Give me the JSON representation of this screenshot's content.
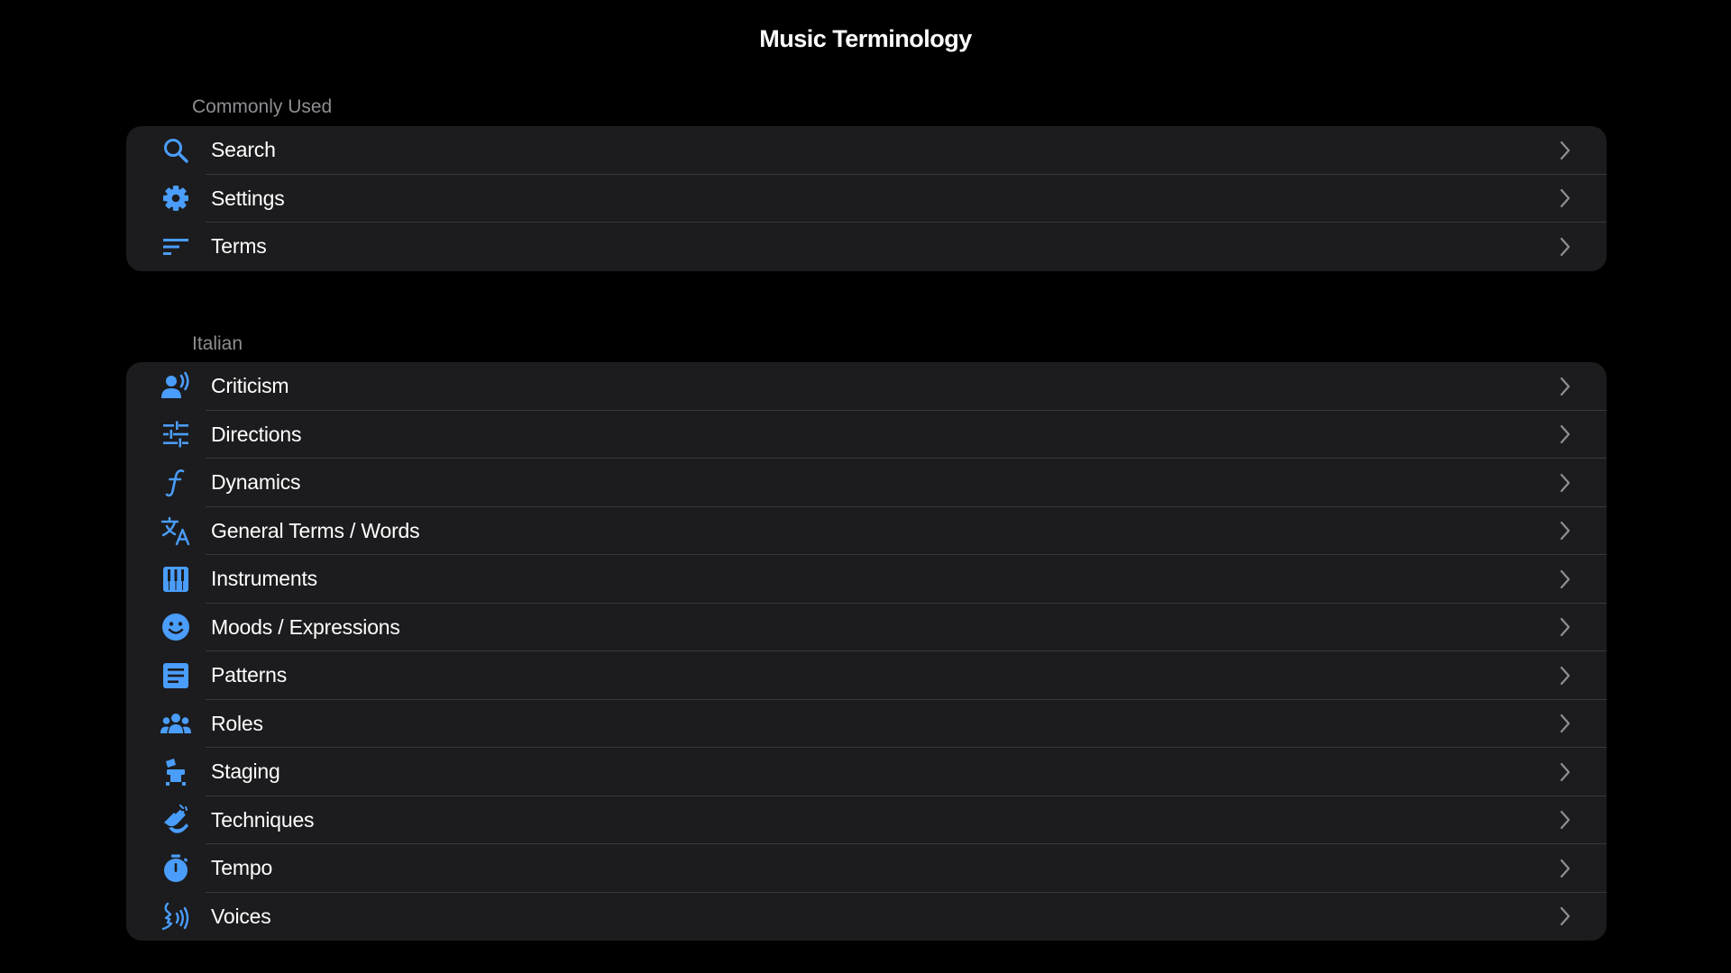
{
  "app": {
    "title": "Music Terminology"
  },
  "colors": {
    "accent": "#4a9dfb",
    "background": "#000000",
    "card": "#1c1c1e",
    "secondary_text": "#8e8e93",
    "chevron": "#8e8e93"
  },
  "sections": [
    {
      "header": "Commonly Used",
      "items": [
        {
          "label": "Search",
          "icon": "search-icon"
        },
        {
          "label": "Settings",
          "icon": "gear-icon"
        },
        {
          "label": "Terms",
          "icon": "sort-lines-icon"
        }
      ]
    },
    {
      "header": "Italian",
      "items": [
        {
          "label": "Criticism",
          "icon": "person-speaking-icon"
        },
        {
          "label": "Directions",
          "icon": "sliders-icon"
        },
        {
          "label": "Dynamics",
          "icon": "forte-f-icon"
        },
        {
          "label": "General Terms / Words",
          "icon": "translate-icon"
        },
        {
          "label": "Instruments",
          "icon": "piano-icon"
        },
        {
          "label": "Moods / Expressions",
          "icon": "smiley-face-icon"
        },
        {
          "label": "Patterns",
          "icon": "notes-text-icon"
        },
        {
          "label": "Roles",
          "icon": "group-people-icon"
        },
        {
          "label": "Staging",
          "icon": "chair-icon"
        },
        {
          "label": "Techniques",
          "icon": "hands-gesture-icon"
        },
        {
          "label": "Tempo",
          "icon": "stopwatch-icon"
        },
        {
          "label": "Voices",
          "icon": "voice-wave-icon"
        }
      ]
    }
  ]
}
